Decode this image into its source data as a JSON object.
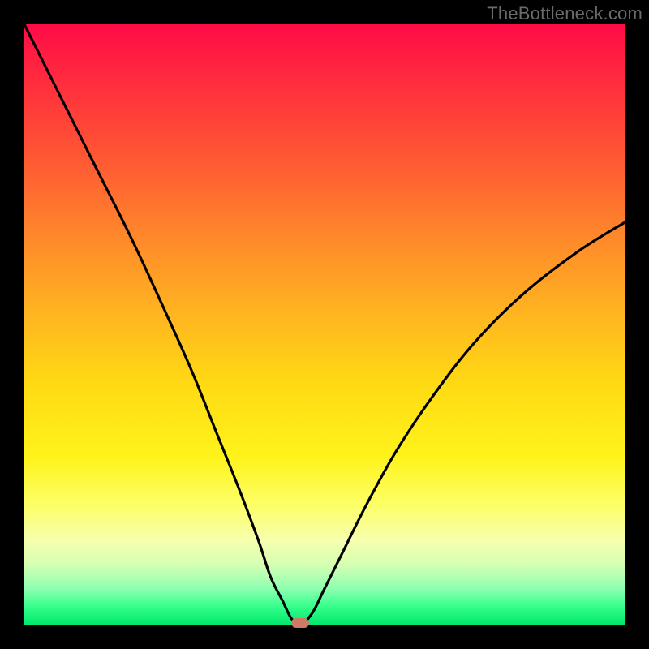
{
  "watermark": {
    "text": "TheBottleneck.com"
  },
  "chart_data": {
    "type": "line",
    "title": "",
    "xlabel": "",
    "ylabel": "",
    "xlim": [
      0,
      100
    ],
    "ylim": [
      0,
      100
    ],
    "legend": false,
    "grid": false,
    "background": "rainbow-vertical-gradient",
    "series": [
      {
        "name": "bottleneck-curve",
        "x": [
          0,
          6,
          12,
          18,
          24,
          28,
          32,
          36,
          39,
          41,
          43,
          44.5,
          46,
          48,
          50,
          53,
          57,
          62,
          68,
          75,
          83,
          92,
          100
        ],
        "values": [
          100,
          88,
          76,
          64,
          51,
          42,
          32,
          22,
          14,
          8,
          4,
          1,
          0,
          2,
          6,
          12,
          20,
          29,
          38,
          47,
          55,
          62,
          67
        ]
      }
    ],
    "marker": {
      "x": 46,
      "y": 0,
      "color": "#cf7a66"
    },
    "annotations": []
  }
}
